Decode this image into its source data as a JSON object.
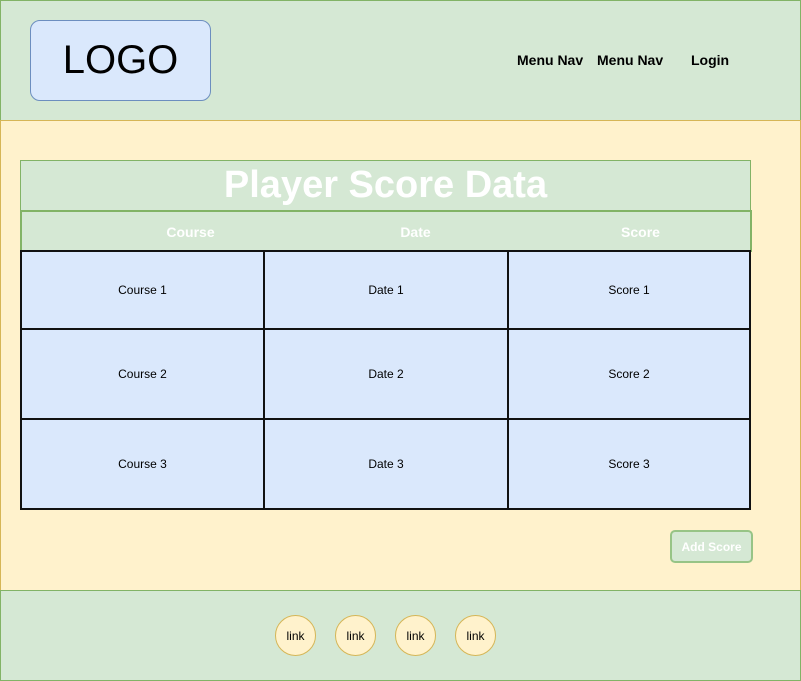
{
  "header": {
    "logo": "LOGO",
    "nav": [
      "Menu Nav",
      "Menu Nav"
    ],
    "login": "Login"
  },
  "main": {
    "title": "Player Score Data",
    "table": {
      "columns": [
        "Course",
        "Date",
        "Score"
      ],
      "rows": [
        [
          "Course 1",
          "Date 1",
          "Score 1"
        ],
        [
          "Course 2",
          "Date 2",
          "Score 2"
        ],
        [
          "Course 3",
          "Date 3",
          "Score 3"
        ]
      ]
    },
    "add_button": "Add Score"
  },
  "footer": {
    "links": [
      "link",
      "link",
      "link",
      "link"
    ]
  },
  "colors": {
    "header_bg": "#d5e8d4",
    "main_bg": "#fff2cc",
    "cell_bg": "#dae8fc",
    "border_green": "#82b366"
  }
}
